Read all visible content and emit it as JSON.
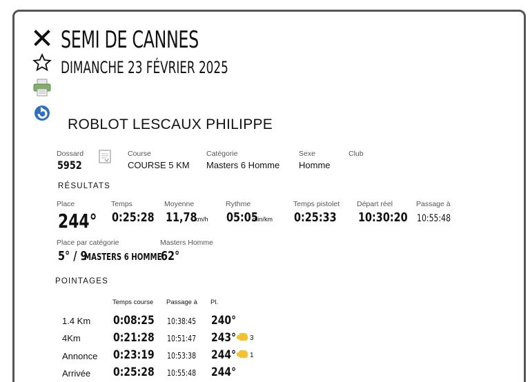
{
  "event": {
    "title": "SEMI DE CANNES",
    "date": "DIMANCHE 23 FÉVRIER 2025"
  },
  "icons": {
    "close": "close-icon",
    "favorite": "star-icon",
    "print": "printer-icon",
    "refresh": "refresh-icon",
    "document": "document-icon"
  },
  "runner": {
    "name": "ROBLOT LESCAUX PHILIPPE",
    "bib_label": "Dossard",
    "bib": "5952",
    "course_label": "Course",
    "course": "COURSE 5 KM",
    "category_label": "Catégorie",
    "category": "Masters 6 Homme",
    "sex_label": "Sexe",
    "sex": "Homme",
    "club_label": "Club",
    "club": ""
  },
  "results": {
    "heading": "RÉSULTATS",
    "place_label": "Place",
    "place": "244°",
    "time_label": "Temps",
    "time": "0:25:28",
    "avg_label": "Moyenne",
    "avg": "11,78",
    "avg_unit": "km/h",
    "pace_label": "Rythme",
    "pace": "05:05",
    "pace_unit": "min/km",
    "gun_label": "Temps pistolet",
    "gun": "0:25:33",
    "start_label": "Départ réel",
    "start": "10:30:20",
    "pass_label": "Passage à",
    "pass": "10:55:48",
    "cat_place_label": "Place par catégorie",
    "cat_place": "5° / 9",
    "cat_place_cat": "MASTERS 6 HOMME",
    "masters_label": "Masters Homme",
    "masters_place": "62°"
  },
  "splits": {
    "heading": "POINTAGES",
    "col_time": "Temps course",
    "col_pass": "Passage à",
    "col_place": "Pl.",
    "rows": [
      {
        "label": "1.4 Km",
        "time": "0:08:25",
        "pass": "10:38:45",
        "place": "240°",
        "gain": ""
      },
      {
        "label": "4Km",
        "time": "0:21:28",
        "pass": "10:51:47",
        "place": "243°",
        "gain": "3"
      },
      {
        "label": "Annonce",
        "time": "0:23:19",
        "pass": "10:53:38",
        "place": "244°",
        "gain": "1"
      },
      {
        "label": "Arrivée",
        "time": "0:25:28",
        "pass": "10:55:48",
        "place": "244°",
        "gain": ""
      }
    ]
  },
  "colors": {
    "border": "#555555",
    "hand": "#f2c230",
    "refresh": "#2f6fc0"
  }
}
